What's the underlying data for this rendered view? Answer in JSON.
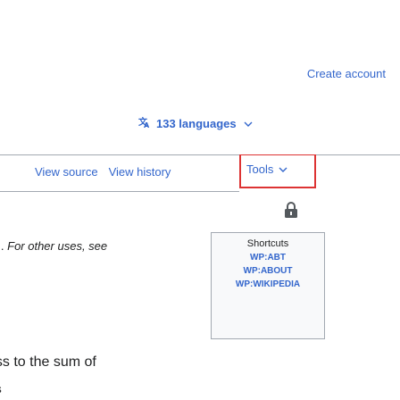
{
  "header": {
    "create_account": "Create account"
  },
  "languages": {
    "label": "133 languages",
    "icon": "translate-icon",
    "chevron": "chevron-down-icon"
  },
  "tabs": {
    "view_source": "View source",
    "view_history": "View history",
    "tools": "Tools"
  },
  "content": {
    "hatnote_left": "l. ",
    "hatnote_rest": "For other uses, see",
    "lower_line_1": "ess to the sum of",
    "lower_line_2": "es"
  },
  "shortcuts": {
    "title": "Shortcuts",
    "items": [
      "WP:ABT",
      "WP:ABOUT",
      "WP:WIKIPEDIA"
    ]
  },
  "colors": {
    "link": "#3366cc",
    "highlight_border": "#dd3333",
    "divider": "#a2a9b1"
  }
}
